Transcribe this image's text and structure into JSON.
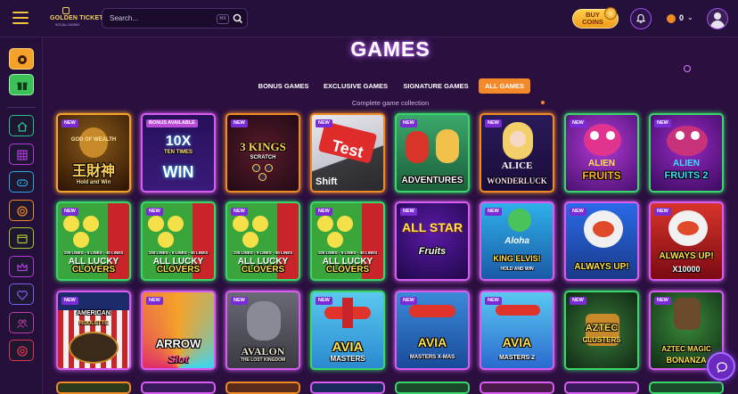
{
  "header": {
    "brand_title": "GOLDEN TICKET",
    "brand_sub": "SOCIAL CASINO",
    "search_placeholder": "Search...",
    "search_shortcut": "⌘K",
    "buy_coins_label": "BUY COINS",
    "balance": "0",
    "icons": [
      "menu-icon",
      "search-icon",
      "bell-icon",
      "coin-icon",
      "chevron-down-icon",
      "user-icon"
    ]
  },
  "sidebar": {
    "items": [
      {
        "name": "sidebar-item-record",
        "icon": "record-icon",
        "color": "#f4a22a"
      },
      {
        "name": "sidebar-item-gift",
        "icon": "gift-icon",
        "color": "#3cc15a"
      },
      {
        "name": "sidebar-item-home",
        "icon": "home-icon",
        "color": "#2bbf8a"
      },
      {
        "name": "sidebar-item-grid",
        "icon": "grid-icon",
        "color": "#b53be0"
      },
      {
        "name": "sidebar-item-games",
        "icon": "gamepad-icon",
        "color": "#2aa6d8"
      },
      {
        "name": "sidebar-item-coin",
        "icon": "coin-icon",
        "color": "#f08a23"
      },
      {
        "name": "sidebar-item-wallet",
        "icon": "wallet-icon",
        "color": "#a7c92a"
      },
      {
        "name": "sidebar-item-crown",
        "icon": "crown-icon",
        "color": "#b53be0"
      },
      {
        "name": "sidebar-item-favorites",
        "icon": "heart-icon",
        "color": "#7b5cf0"
      },
      {
        "name": "sidebar-item-users",
        "icon": "users-icon",
        "color": "#c03ba8"
      },
      {
        "name": "sidebar-item-support",
        "icon": "lifebuoy-icon",
        "color": "#e0364e"
      }
    ]
  },
  "main": {
    "title": "GAMES",
    "tabs": [
      {
        "label": "BONUS GAMES",
        "active": false
      },
      {
        "label": "EXCLUSIVE GAMES",
        "active": false
      },
      {
        "label": "SIGNATURE GAMES",
        "active": false
      },
      {
        "label": "ALL GAMES",
        "active": true
      }
    ],
    "subtitle": "Complete game collection",
    "games": [
      {
        "badge": "NEW",
        "title": "王財神",
        "top": "GOD OF WEALTH",
        "sub": "Hold and Win"
      },
      {
        "badge": "BONUS AVAILABLE",
        "title": "WIN",
        "top": "10X",
        "sub": "TEN TIMES"
      },
      {
        "badge": "NEW",
        "title": "3 KINGS",
        "top": "",
        "sub": "SCRATCH"
      },
      {
        "badge": "NEW",
        "title": "Test",
        "top": "",
        "sub": "Shift"
      },
      {
        "badge": "NEW",
        "title": "ADVENTURES",
        "top": "",
        "sub": ""
      },
      {
        "badge": "NEW",
        "title": "WONDERLUCK",
        "top": "ALICE",
        "sub": ""
      },
      {
        "badge": "NEW",
        "title": "FRUITS",
        "top": "ALIEN",
        "sub": ""
      },
      {
        "badge": "NEW",
        "title": "FRUITS 2",
        "top": "ALIEN",
        "sub": ""
      },
      {
        "badge": "NEW",
        "title": "CLOVERS",
        "top": "ALL LUCKY",
        "sub": "100 LINES · 5 LINES · 40 LINES"
      },
      {
        "badge": "NEW",
        "title": "CLOVERS",
        "top": "ALL LUCKY",
        "sub": "100 LINES · 5 LINES · 40 LINES"
      },
      {
        "badge": "NEW",
        "title": "CLOVERS",
        "top": "ALL LUCKY",
        "sub": "100 LINES · 5 LINES · 40 LINES"
      },
      {
        "badge": "NEW",
        "title": "CLOVERS",
        "top": "ALL LUCKY",
        "sub": "100 LINES · 5 LINES · 40 LINES"
      },
      {
        "badge": "NEW",
        "title": "Fruits",
        "top": "ALL STAR",
        "sub": ""
      },
      {
        "badge": "NEW",
        "title": "KING ELVIS!",
        "top": "Aloha",
        "sub": "HOLD AND WIN"
      },
      {
        "badge": "NEW",
        "title": "ALWAYS UP!",
        "top": "",
        "sub": ""
      },
      {
        "badge": "NEW",
        "title": "ALWAYS UP!",
        "top": "",
        "sub": "X10000"
      },
      {
        "badge": "NEW",
        "title": "AMERICAN",
        "top": "",
        "sub": "ROULETTE"
      },
      {
        "badge": "NEW",
        "title": "ARROW",
        "top": "",
        "sub": "Slot"
      },
      {
        "badge": "NEW",
        "title": "AVALON",
        "top": "",
        "sub": "THE LOST KINGDOM"
      },
      {
        "badge": "NEW",
        "title": "AVIA",
        "top": "",
        "sub": "MASTERS"
      },
      {
        "badge": "NEW",
        "title": "AVIA",
        "top": "",
        "sub": "MASTERS X-MAS"
      },
      {
        "badge": "NEW",
        "title": "AVIA",
        "top": "",
        "sub": "MASTERS 2"
      },
      {
        "badge": "NEW",
        "title": "AZTEC",
        "top": "",
        "sub": "CLUSTERS"
      },
      {
        "badge": "NEW",
        "title": "AZTEC MAGIC",
        "top": "",
        "sub": "BONANZA"
      }
    ]
  },
  "chat": {
    "icon": "chat-icon"
  },
  "colors": {
    "accent": "#f4892a",
    "brand": "#a24ff0",
    "background": "#2a0f3f"
  }
}
